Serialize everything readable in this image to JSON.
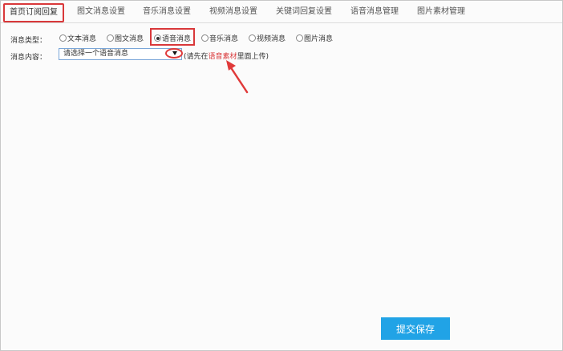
{
  "tabs": [
    {
      "label": "首页订阅回复"
    },
    {
      "label": "图文消息设置"
    },
    {
      "label": "音乐消息设置"
    },
    {
      "label": "视频消息设置"
    },
    {
      "label": "关键词回复设置"
    },
    {
      "label": "语音消息管理"
    },
    {
      "label": "图片素材管理"
    }
  ],
  "form": {
    "type_label": "消息类型：",
    "content_label": "消息内容：",
    "types": [
      {
        "label": "文本消息",
        "checked": false
      },
      {
        "label": "图文消息",
        "checked": false
      },
      {
        "label": "语音消息",
        "checked": true
      },
      {
        "label": "音乐消息",
        "checked": false
      },
      {
        "label": "视频消息",
        "checked": false
      },
      {
        "label": "图片消息",
        "checked": false
      }
    ],
    "select_value": "请选择一个语音消息",
    "hint_prefix": "(请先在",
    "hint_link": "语音素材",
    "hint_suffix": "里面上传)"
  },
  "submit_label": "提交保存",
  "colors": {
    "highlight": "#d9383a",
    "button": "#21a3e6"
  }
}
